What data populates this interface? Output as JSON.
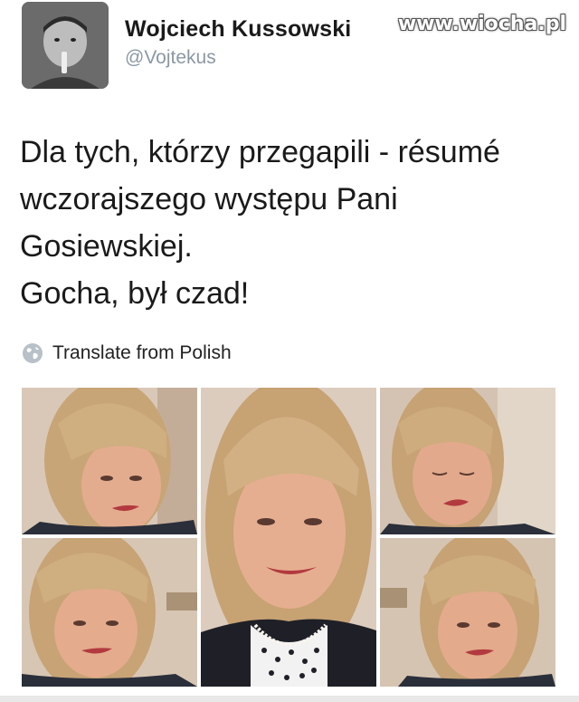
{
  "tweet": {
    "author_name": "Wojciech Kussowski",
    "author_handle": "@Vojtekus",
    "watermark": "www.wiocha.pl",
    "text_lines": [
      "Dla tych, którzy przegapili - résumé",
      "wczorajszego występu Pani",
      "Gosiewskiej.",
      "Gocha, był czad!"
    ],
    "translate_label": "Translate from Polish"
  },
  "colors": {
    "handle": "#8b98a5",
    "text": "#1a1a1a",
    "hair": "#c9a77a",
    "skin": "#e3a98a",
    "lips": "#b23a3f",
    "background_wall": "#d8c7b6"
  },
  "media": {
    "photos": [
      {
        "name": "photo-top-left",
        "description": "woman with blonde bangs, smirk"
      },
      {
        "name": "photo-center-large",
        "description": "woman with blonde hair and pearl necklace, smiling"
      },
      {
        "name": "photo-top-right",
        "description": "woman with eyes closed, pursed lips"
      },
      {
        "name": "photo-bottom-left",
        "description": "woman with blonde bangs, looking aside"
      },
      {
        "name": "photo-bottom-right",
        "description": "woman smiling slightly"
      }
    ]
  }
}
